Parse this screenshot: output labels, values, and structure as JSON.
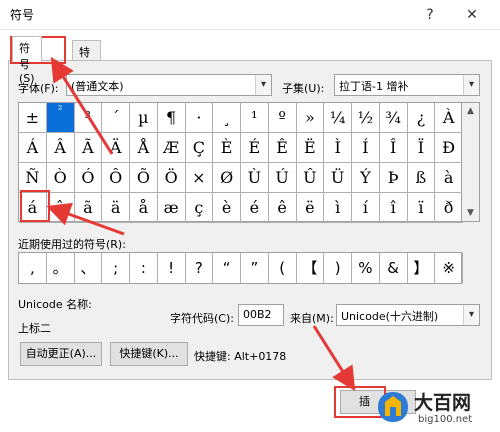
{
  "window": {
    "title": "符号",
    "help_label": "?",
    "close_label": "✕"
  },
  "tabs": [
    {
      "label": "符号(S)"
    },
    {
      "label": "特殊字符(P)"
    }
  ],
  "font": {
    "label": "字体(F):",
    "value": "(普通文本)"
  },
  "subset": {
    "label": "子集(U):",
    "value": "拉丁语-1 增补"
  },
  "symbol_grid": {
    "rows": [
      [
        "±",
        "²",
        "³",
        "´",
        "µ",
        "¶",
        "·",
        "¸",
        "¹",
        "º",
        "»",
        "¼",
        "½",
        "¾",
        "¿",
        "À"
      ],
      [
        "Á",
        "Â",
        "Ã",
        "Ä",
        "Å",
        "Æ",
        "Ç",
        "È",
        "É",
        "Ê",
        "Ë",
        "Ì",
        "Í",
        "Î",
        "Ï",
        "Ð"
      ],
      [
        "Ñ",
        "Ò",
        "Ó",
        "Ô",
        "Õ",
        "Ö",
        "×",
        "Ø",
        "Ù",
        "Ú",
        "Û",
        "Ü",
        "Ý",
        "Þ",
        "ß",
        "à"
      ],
      [
        "á",
        "â",
        "ã",
        "ä",
        "å",
        "æ",
        "ç",
        "è",
        "é",
        "ê",
        "ë",
        "ì",
        "í",
        "î",
        "ï",
        "ð"
      ]
    ],
    "selected": {
      "row": 0,
      "col": 1
    }
  },
  "recent": {
    "label": "近期使用过的符号(R):",
    "items": [
      ",",
      "。",
      "、",
      ";",
      ":",
      "!",
      "?",
      "“",
      "”",
      "(",
      "【",
      ")",
      "%",
      "&",
      "】",
      "※"
    ]
  },
  "unicode_name": {
    "label": "Unicode 名称:",
    "value": "上标二"
  },
  "char_code": {
    "label": "字符代码(C):",
    "value": "00B2"
  },
  "from": {
    "label": "来自(M):",
    "value": "Unicode(十六进制)"
  },
  "buttons": {
    "autocorrect": "自动更正(A)...",
    "shortcut_key": "快捷键(K)...",
    "shortcut_text": "快捷键: Alt+0178",
    "insert": "插"
  },
  "watermark": {
    "title": "大百网",
    "url": "big100.net"
  },
  "colors": {
    "selection": "#0a6fd8",
    "highlight": "#e53935"
  }
}
